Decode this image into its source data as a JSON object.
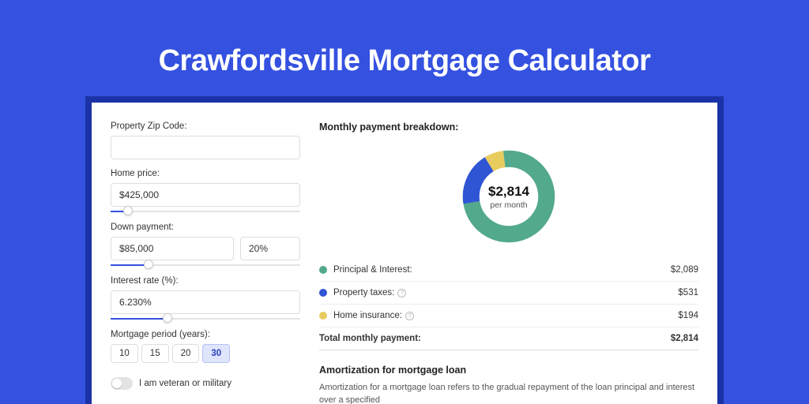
{
  "page": {
    "title": "Crawfordsville Mortgage Calculator"
  },
  "form": {
    "zip": {
      "label": "Property Zip Code:",
      "value": ""
    },
    "home_price": {
      "label": "Home price:",
      "value": "$425,000",
      "slider_pct": 9
    },
    "down_payment": {
      "label": "Down payment:",
      "value": "$85,000",
      "pct": "20%",
      "slider_pct": 20
    },
    "interest": {
      "label": "Interest rate (%):",
      "value": "6.230%",
      "slider_pct": 30
    },
    "period": {
      "label": "Mortgage period (years):",
      "options": [
        "10",
        "15",
        "20",
        "30"
      ],
      "selected": "30"
    },
    "veteran": {
      "label": "I am veteran or military"
    }
  },
  "breakdown": {
    "title": "Monthly payment breakdown:",
    "center_value": "$2,814",
    "center_label": "per month",
    "items": [
      {
        "label": "Principal & Interest:",
        "value": "$2,089",
        "symbol": "g"
      },
      {
        "label": "Property taxes:",
        "value": "$531",
        "symbol": "b",
        "info": true
      },
      {
        "label": "Home insurance:",
        "value": "$194",
        "symbol": "y",
        "info": true
      }
    ],
    "total_label": "Total monthly payment:",
    "total_value": "$2,814"
  },
  "amort": {
    "title": "Amortization for mortgage loan",
    "text": "Amortization for a mortgage loan refers to the gradual repayment of the loan principal and interest over a specified"
  },
  "chart_data": {
    "type": "pie",
    "title": "Monthly payment breakdown",
    "categories": [
      "Principal & Interest",
      "Property taxes",
      "Home insurance"
    ],
    "values": [
      2089,
      531,
      194
    ],
    "colors": [
      "#52a98c",
      "#2f55d4",
      "#e9cc5e"
    ],
    "total": 2814,
    "center_label": "per month"
  }
}
